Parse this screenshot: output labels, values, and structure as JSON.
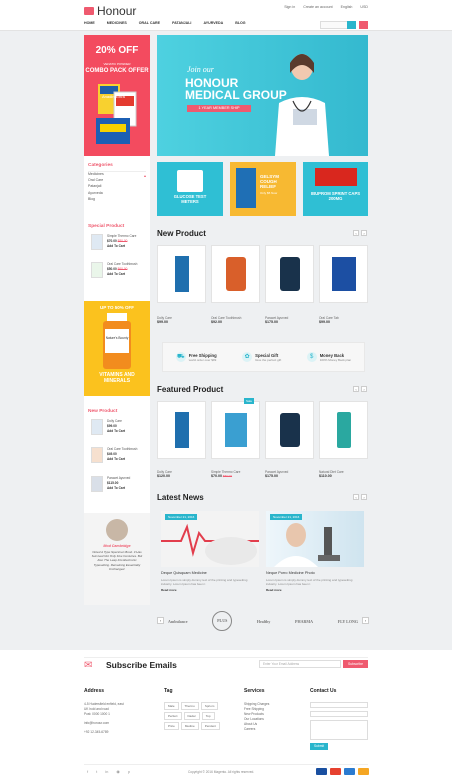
{
  "header": {
    "logo": "Honour",
    "top_links": [
      "Sign in",
      "Create an account",
      "English",
      "USD"
    ],
    "nav": [
      "HOME",
      "MEDICINES",
      "ORAL CARE",
      "PATANJALI",
      "AYURVEDA",
      "BLOG"
    ]
  },
  "sidebar": {
    "promo": {
      "percent": "20% OFF",
      "small": "VENATIC POWDER",
      "title": "COMBO PACK OFFER",
      "product_label": "Anadin Extra"
    },
    "categories_title": "Categories",
    "categories": [
      "Medicines",
      "Oral Care",
      "Patanjali",
      "Ayurveda",
      "Blog"
    ],
    "special_title": "Special Product",
    "special": [
      {
        "name": "Simple Thermo Care",
        "price": "$70.00",
        "old": "$80.00",
        "action": "Add To Cart"
      },
      {
        "name": "Oral Care Toothbrush",
        "price": "$50.00",
        "old": "$60.00",
        "action": "Add To Cart"
      }
    ],
    "promo2": {
      "top": "UP TO 50% OFF",
      "product_label": "Nature's Bounty",
      "bottom": "VITAMINS AND MINERALS"
    },
    "new_title": "New Product",
    "new_items": [
      {
        "name": "Dolly Care",
        "price": "$99.00",
        "action": "Add To Cart"
      },
      {
        "name": "Oral Care Toothbrush",
        "price": "$49.00",
        "action": "Add To Cart"
      },
      {
        "name": "Paracet Ayurved",
        "price": "$115.00",
        "action": "Add To Cart"
      }
    ],
    "testimonial": {
      "name": "Mod Cambridge",
      "text": "Noted A Type Specimen Book. It Has Survived Not Only Five Centuries. But Also The Leap Into Electronic Typesetting. Remaining Essentially Unchanged."
    }
  },
  "hero": {
    "line1": "Join our",
    "line2": "HONOUR",
    "line3": "MEDICAL GROUP",
    "badge": "1 YEAR MEMBER SHIP"
  },
  "banners": [
    {
      "title": "GLUCOSE TEST METERS",
      "color": "#2fbfd4"
    },
    {
      "title": "GELSYM COUGH RELIEF",
      "sub": "Only $5 Now",
      "color": "#f7b932"
    },
    {
      "title": "IBUPROM SPRINT CAPS 200MG",
      "color": "#2fbfd4"
    }
  ],
  "new_product": {
    "title": "New Product",
    "items": [
      {
        "name": "Dolly Care",
        "price": "$99.00",
        "color": "#1f6fae"
      },
      {
        "name": "Oral Care Toothbrush",
        "price": "$92.00",
        "color": "#d95f2a"
      },
      {
        "name": "Paracet Ayurved",
        "price": "$175.00",
        "color": "#19324b"
      },
      {
        "name": "Oral Care Tab",
        "price": "$99.00",
        "color": "#1c4fa3"
      }
    ]
  },
  "features": [
    {
      "title": "Free Shipping",
      "sub": "world order over $99",
      "icon": "truck-icon"
    },
    {
      "title": "Special Gift",
      "sub": "Give the perfect gift",
      "icon": "gift-icon"
    },
    {
      "title": "Money Back",
      "sub": "100% Money Back plan",
      "icon": "money-icon"
    }
  ],
  "featured_product": {
    "title": "Featured Product",
    "items": [
      {
        "name": "Dolly Care",
        "price": "$120.00",
        "color": "#1f6fae"
      },
      {
        "name": "Simple Thermo Care",
        "price": "$70.00",
        "old": "$80.00",
        "badge": "Sale",
        "color": "#3a9fd1"
      },
      {
        "name": "Paracet Ayurved",
        "price": "$175.00",
        "color": "#19324b"
      },
      {
        "name": "Natural Diet Care",
        "price": "$110.00",
        "color": "#2aa8a0"
      }
    ]
  },
  "latest_news": {
    "title": "Latest News",
    "items": [
      {
        "date": "November 21, 2016",
        "title": "Deque Quisquam Medicine",
        "text": "Lorem Ipsum is simply dummy text of the printing and typesetting industry. Lorem Ipsum has been t",
        "more": "Read more"
      },
      {
        "date": "November 21, 2016",
        "title": "Neque Porro Medicine Photo",
        "text": "Lorem Ipsum is simply dummy text of the printing and typesetting industry. Lorem Ipsum has been t",
        "more": "Read more"
      }
    ]
  },
  "brands": [
    "Ambulance",
    "PLUS",
    "Healthy",
    "PHARMA",
    "FLY LONG"
  ],
  "footer": {
    "subscribe": "Subscribe Emails",
    "email_placeholder": "Enter Your Email Address",
    "subscribe_btn": "Subscribe",
    "address_title": "Address",
    "address": [
      "4-5 Hudersfield enfield, east",
      "UK hold and road",
      "Post: 0000 1000 1"
    ],
    "email": "info@honour.com",
    "phone": "+92 12-345-6789",
    "tag_title": "Tag",
    "tags": [
      "Male",
      "Thermo",
      "Spriom",
      "Perfect",
      "Dadar",
      "Top",
      "Price",
      "Medine",
      "Pendent"
    ],
    "services_title": "Services",
    "services": [
      "Shipping Charges",
      "Free Shipping",
      "New Products",
      "Our Locations",
      "About Us",
      "Careers"
    ],
    "contact_title": "Contact Us",
    "contact_btn": "Submit",
    "copyright": "Copyright © 2016 Magento. All rights reserved."
  }
}
